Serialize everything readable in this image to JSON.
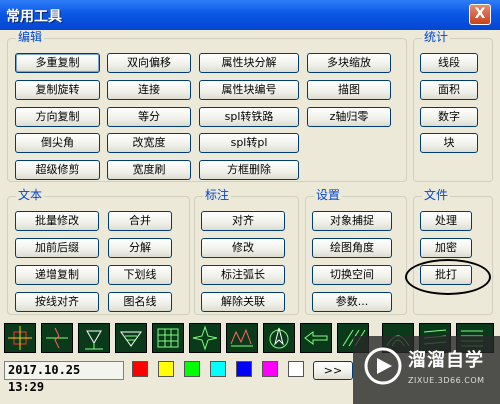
{
  "window": {
    "title": "常用工具",
    "close_glyph": "X"
  },
  "groups": {
    "edit": {
      "label": "编辑",
      "buttons": [
        "多重复制",
        "双向偏移",
        "属性块分解",
        "多块缩放",
        "复制旋转",
        "连接",
        "属性块编号",
        "描图",
        "方向复制",
        "等分",
        "spl转铁路",
        "z轴归零",
        "倒尖角",
        "改宽度",
        "spl转pl",
        "超级修剪",
        "宽度刷",
        "方框删除"
      ]
    },
    "stats": {
      "label": "统计",
      "buttons": [
        "线段",
        "面积",
        "数字",
        "块"
      ]
    },
    "text": {
      "label": "文本",
      "buttons": [
        "批量修改",
        "合并",
        "加前后缀",
        "分解",
        "递增复制",
        "下划线",
        "按线对齐",
        "图名线"
      ]
    },
    "annotate": {
      "label": "标注",
      "buttons": [
        "对齐",
        "修改",
        "标注弧长",
        "解除关联"
      ]
    },
    "settings": {
      "label": "设置",
      "buttons": [
        "对象捕捉",
        "绘图角度",
        "切换空间",
        "参数..."
      ]
    },
    "file": {
      "label": "文件",
      "buttons": [
        "处理",
        "加密",
        "批打"
      ]
    }
  },
  "toolbar": {
    "icons": [
      "crosshair-icon",
      "line-break-icon",
      "triangle-marker-icon",
      "arrow-hatch-icon",
      "grid-table-icon",
      "star-icon",
      "polyline-icon",
      "north-arrow-icon",
      "arrow-left-icon",
      "hatch-icon",
      "arc-icon",
      "stripes-icon",
      "stacked-lines-icon"
    ]
  },
  "status": {
    "datetime": "2017.10.25  13:29",
    "swatches": [
      "#ff0000",
      "#ffff00",
      "#00ff00",
      "#00ffff",
      "#0000ff",
      "#ff00ff",
      "#ffffff"
    ],
    "more_label": ">>"
  },
  "watermark": {
    "brand": "溜溜自学",
    "sub": "ZIXUE.3D66.COM"
  }
}
